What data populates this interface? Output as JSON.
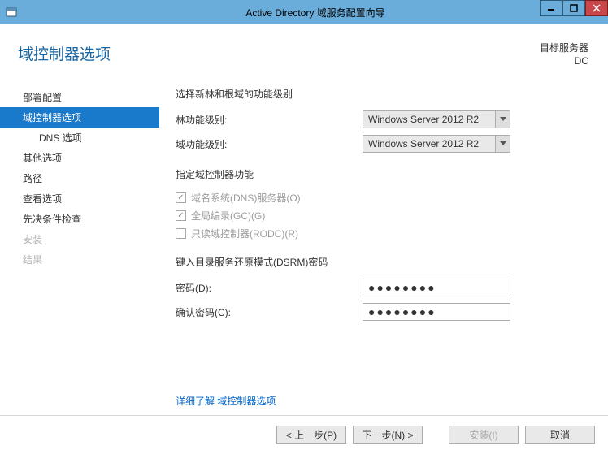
{
  "titlebar": {
    "title": "Active Directory 域服务配置向导"
  },
  "header": {
    "page_title": "域控制器选项",
    "target_label": "目标服务器",
    "target_value": "DC"
  },
  "sidebar": {
    "items": [
      {
        "label": "部署配置",
        "state": "enabled"
      },
      {
        "label": "域控制器选项",
        "state": "selected"
      },
      {
        "label": "DNS 选项",
        "state": "sub"
      },
      {
        "label": "其他选项",
        "state": "enabled"
      },
      {
        "label": "路径",
        "state": "enabled"
      },
      {
        "label": "查看选项",
        "state": "enabled"
      },
      {
        "label": "先决条件检查",
        "state": "enabled"
      },
      {
        "label": "安装",
        "state": "disabled"
      },
      {
        "label": "结果",
        "state": "disabled"
      }
    ]
  },
  "main": {
    "section1_title": "选择新林和根域的功能级别",
    "forest_label": "林功能级别:",
    "forest_value": "Windows Server 2012 R2",
    "domain_label": "域功能级别:",
    "domain_value": "Windows Server 2012 R2",
    "section2_title": "指定域控制器功能",
    "chk_dns": "域名系统(DNS)服务器(O)",
    "chk_gc": "全局编录(GC)(G)",
    "chk_rodc": "只读域控制器(RODC)(R)",
    "section3_title": "键入目录服务还原模式(DSRM)密码",
    "pw_label": "密码(D):",
    "pw_value": "●●●●●●●●",
    "pw_confirm_label": "确认密码(C):",
    "pw_confirm_value": "●●●●●●●●",
    "link_text": "详细了解 域控制器选项"
  },
  "footer": {
    "prev": "< 上一步(P)",
    "next": "下一步(N) >",
    "install": "安装(I)",
    "cancel": "取消"
  }
}
